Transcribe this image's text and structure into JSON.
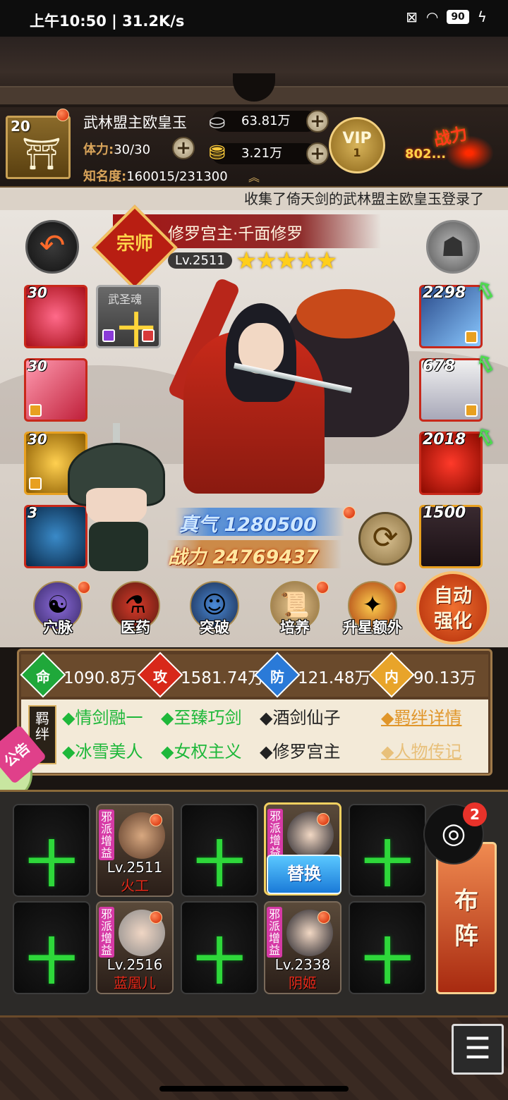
{
  "status_bar": {
    "time": "上午10:50",
    "speed": "31.2K/s",
    "battery": "90"
  },
  "player": {
    "level": "20",
    "name": "武林盟主欧皇玉",
    "stamina_label": "体力:",
    "stamina_value": "30/30",
    "fame_label": "知名度:",
    "fame_value": "160015/231300",
    "silver": "63.81万",
    "gold": "3.21万",
    "vip_label": "VIP",
    "vip_level": "1",
    "power_label": "战力",
    "power_value": "802..."
  },
  "ticker": "收集了倚天剑的武林盟主欧皇玉登录了",
  "hero": {
    "rank_badge": "宗师",
    "title": "修罗宫主·千面修罗",
    "level": "Lv.2511",
    "stars": "★★★★★",
    "zhenqi": "真气 1280500",
    "zhanli": "战力 24769437"
  },
  "left_slots": [
    "30",
    "30",
    "30",
    "3"
  ],
  "soul": {
    "title": "武圣魂",
    "symbol": "十"
  },
  "right_slots": [
    "2298",
    "678",
    "2018",
    "1500"
  ],
  "functions": [
    "穴脉",
    "医药",
    "突破",
    "培养",
    "升星额外"
  ],
  "auto_button": [
    "自动",
    "强化"
  ],
  "stats": [
    {
      "label": "命",
      "value": "1090.8万",
      "color": "#1fa83a"
    },
    {
      "label": "攻",
      "value": "1581.74万",
      "color": "#d8281a"
    },
    {
      "label": "防",
      "value": "121.48万",
      "color": "#2a7ad8"
    },
    {
      "label": "内",
      "value": "90.13万",
      "color": "#e8a42a"
    }
  ],
  "bond_tag": "羁绊",
  "bonds_row1": [
    "◆情剑融一",
    "◆至臻巧剑",
    "◆酒剑仙子"
  ],
  "bonds_row2": [
    "◆冰雪美人",
    "◆女权主义",
    "◆修罗宫主"
  ],
  "bond_links": [
    "◆羁绊详情",
    "◆人物传记"
  ],
  "notice": "公告",
  "formation": {
    "tag": "邪派增益",
    "swap_label": "替换",
    "heroes": [
      {
        "level": "Lv.2511",
        "name": "火工"
      },
      {
        "level": "Lv.2516",
        "name": "蓝凰儿"
      },
      {
        "level": "Lv.2338",
        "name": "阴姬"
      }
    ],
    "empty_symbol": "十"
  },
  "lineup_label": [
    "布",
    "阵"
  ],
  "share_badge": "2",
  "menu_icon": "☰"
}
